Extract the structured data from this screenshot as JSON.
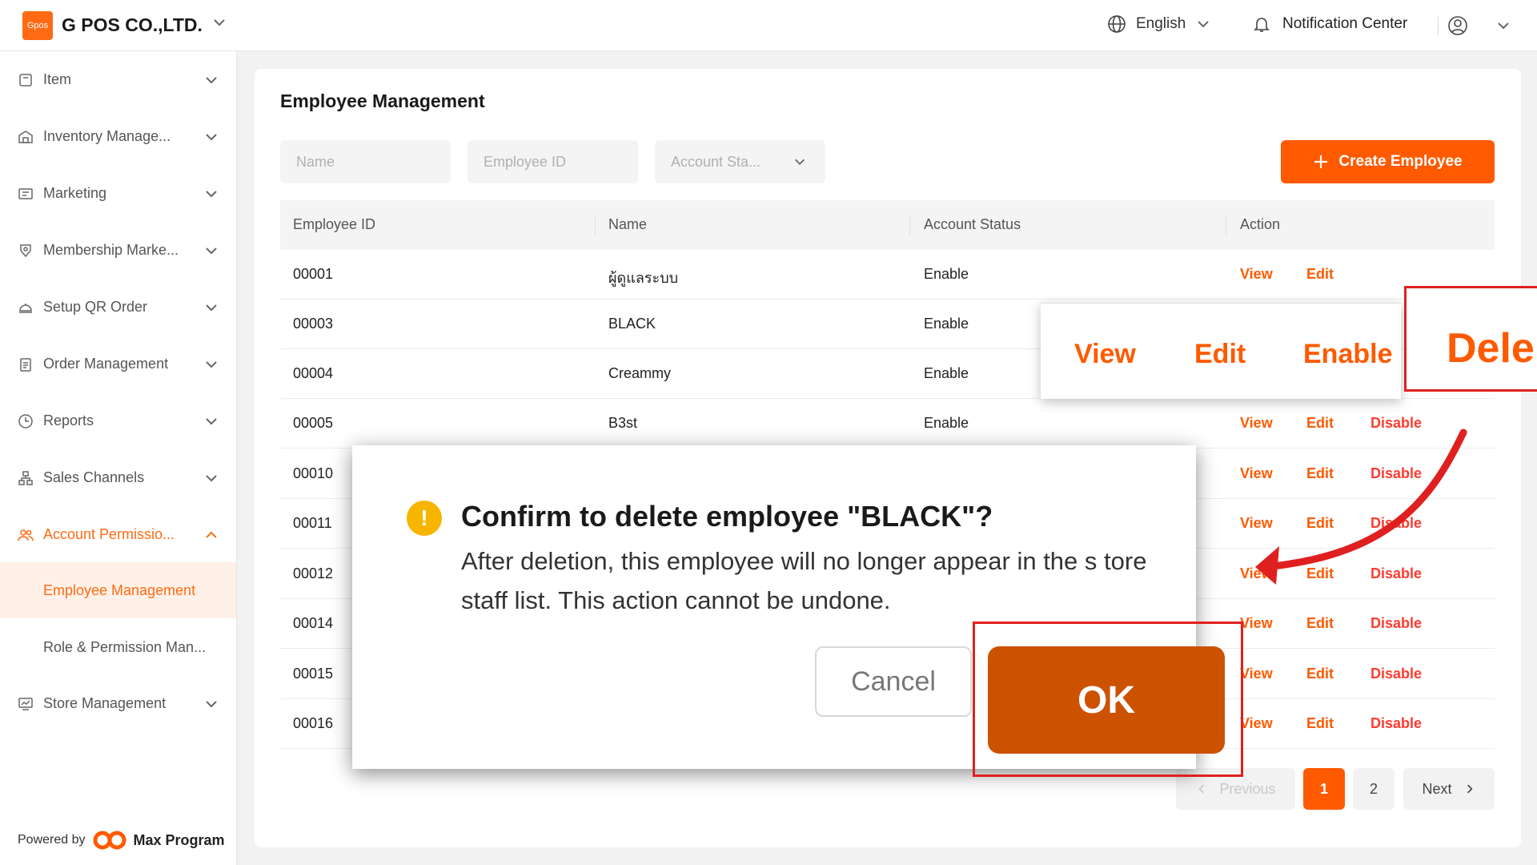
{
  "topbar": {
    "logo_text": "Gpos",
    "company": "G POS CO.,LTD.",
    "language": "English",
    "notification": "Notification Center"
  },
  "sidebar": {
    "items": [
      {
        "label": "Item",
        "icon": "item-icon"
      },
      {
        "label": "Inventory Manage...",
        "icon": "warehouse-icon"
      },
      {
        "label": "Marketing",
        "icon": "coupon-icon"
      },
      {
        "label": "Membership Marke...",
        "icon": "membership-icon"
      },
      {
        "label": "Setup QR Order",
        "icon": "cloche-icon"
      },
      {
        "label": "Order Management",
        "icon": "clipboard-icon"
      },
      {
        "label": "Reports",
        "icon": "clock-icon"
      },
      {
        "label": "Sales Channels",
        "icon": "channels-icon"
      },
      {
        "label": "Account Permissio...",
        "icon": "users-icon"
      },
      {
        "label": "Store Management",
        "icon": "store-icon"
      }
    ],
    "sub_items": [
      "Employee Management",
      "Role & Permission Man..."
    ],
    "powered_by": "Powered by",
    "powered_brand": "Max Program"
  },
  "main": {
    "title": "Employee Management",
    "filters": {
      "name": "Name",
      "employee_id": "Employee ID",
      "status": "Account Sta..."
    },
    "create_button": "Create Employee",
    "columns": [
      "Employee ID",
      "Name",
      "Account Status",
      "Action"
    ],
    "rows": [
      {
        "id": "00001",
        "name": "ผู้ดูแลระบบ",
        "status": "Enable",
        "view": "View",
        "edit": "Edit",
        "toggle": ""
      },
      {
        "id": "00003",
        "name": "BLACK",
        "status": "Enable",
        "view": "",
        "edit": "",
        "toggle": ""
      },
      {
        "id": "00004",
        "name": "Creammy",
        "status": "Enable",
        "view": "",
        "edit": "",
        "toggle": ""
      },
      {
        "id": "00005",
        "name": "B3st",
        "status": "Enable",
        "view": "View",
        "edit": "Edit",
        "toggle": "Disable"
      },
      {
        "id": "00010",
        "name": "",
        "status": "",
        "view": "View",
        "edit": "Edit",
        "toggle": "Disable"
      },
      {
        "id": "00011",
        "name": "",
        "status": "",
        "view": "View",
        "edit": "Edit",
        "toggle": "Disable"
      },
      {
        "id": "00012",
        "name": "",
        "status": "",
        "view": "View",
        "edit": "Edit",
        "toggle": "Disable"
      },
      {
        "id": "00014",
        "name": "",
        "status": "",
        "view": "View",
        "edit": "Edit",
        "toggle": "Disable"
      },
      {
        "id": "00015",
        "name": "",
        "status": "",
        "view": "View",
        "edit": "Edit",
        "toggle": "Disable"
      },
      {
        "id": "00016",
        "name": "",
        "status": "",
        "view": "View",
        "edit": "Edit",
        "toggle": "Disable"
      }
    ],
    "pagination": {
      "previous": "Previous",
      "pages": [
        "1",
        "2"
      ],
      "current": "1",
      "next": "Next"
    }
  },
  "zoom_callout": {
    "view": "View",
    "edit": "Edit",
    "enable": "Enable",
    "delete": "Dele"
  },
  "modal": {
    "title": "Confirm to delete employee \"BLACK\"?",
    "body": "After deletion, this employee will no longer appear in the s tore staff list. This action cannot be undone.",
    "cancel": "Cancel",
    "ok": "OK"
  },
  "colors": {
    "accent": "#ff5a00",
    "ok_button": "#cc5200",
    "highlight": "#e02020",
    "warning": "#f7b500"
  }
}
